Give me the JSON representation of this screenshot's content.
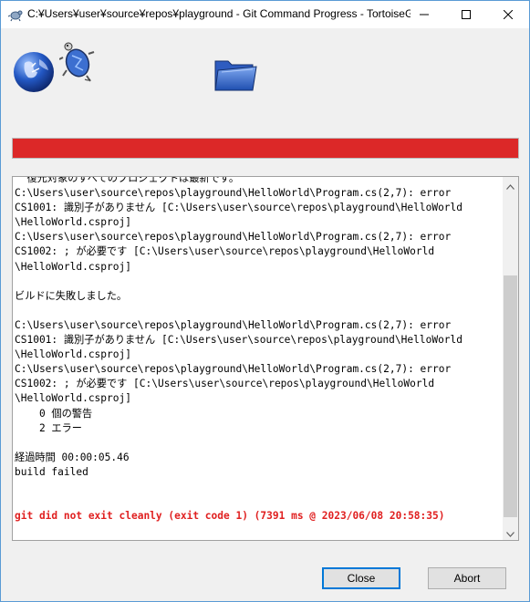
{
  "window": {
    "title": "C:¥Users¥user¥source¥repos¥playground - Git Command Progress - TortoiseGit",
    "accent": "#0078d7"
  },
  "progress": {
    "value": 1.0,
    "color": "#dc2828"
  },
  "log": {
    "lines": [
      {
        "text": "  復元対象のすべてのプロジェクトは最新です。",
        "type": "normal"
      },
      {
        "text": "C:\\Users\\user\\source\\repos\\playground\\HelloWorld\\Program.cs(2,7): error",
        "type": "normal"
      },
      {
        "text": "CS1001: 識別子がありません [C:\\Users\\user\\source\\repos\\playground\\HelloWorld",
        "type": "normal"
      },
      {
        "text": "\\HelloWorld.csproj]",
        "type": "normal"
      },
      {
        "text": "C:\\Users\\user\\source\\repos\\playground\\HelloWorld\\Program.cs(2,7): error",
        "type": "normal"
      },
      {
        "text": "CS1002: ; が必要です [C:\\Users\\user\\source\\repos\\playground\\HelloWorld",
        "type": "normal"
      },
      {
        "text": "\\HelloWorld.csproj]",
        "type": "normal"
      },
      {
        "text": "",
        "type": "normal"
      },
      {
        "text": "ビルドに失敗しました。",
        "type": "normal"
      },
      {
        "text": "",
        "type": "normal"
      },
      {
        "text": "C:\\Users\\user\\source\\repos\\playground\\HelloWorld\\Program.cs(2,7): error",
        "type": "normal"
      },
      {
        "text": "CS1001: 識別子がありません [C:\\Users\\user\\source\\repos\\playground\\HelloWorld",
        "type": "normal"
      },
      {
        "text": "\\HelloWorld.csproj]",
        "type": "normal"
      },
      {
        "text": "C:\\Users\\user\\source\\repos\\playground\\HelloWorld\\Program.cs(2,7): error",
        "type": "normal"
      },
      {
        "text": "CS1002: ; が必要です [C:\\Users\\user\\source\\repos\\playground\\HelloWorld",
        "type": "normal"
      },
      {
        "text": "\\HelloWorld.csproj]",
        "type": "normal"
      },
      {
        "text": "    0 個の警告",
        "type": "normal"
      },
      {
        "text": "    2 エラー",
        "type": "normal"
      },
      {
        "text": "",
        "type": "normal"
      },
      {
        "text": "経過時間 00:00:05.46",
        "type": "normal"
      },
      {
        "text": "build failed",
        "type": "normal"
      },
      {
        "text": "",
        "type": "normal"
      },
      {
        "text": "",
        "type": "normal"
      },
      {
        "text": "git did not exit cleanly (exit code 1) (7391 ms @ 2023/06/08 20:58:35)",
        "type": "error"
      }
    ]
  },
  "buttons": {
    "close": "Close",
    "abort": "Abort"
  },
  "icons": [
    "tortoisegit-icon",
    "globe-icon",
    "turtle-icon",
    "folder-icon",
    "minimize-icon",
    "maximize-icon",
    "close-icon"
  ]
}
